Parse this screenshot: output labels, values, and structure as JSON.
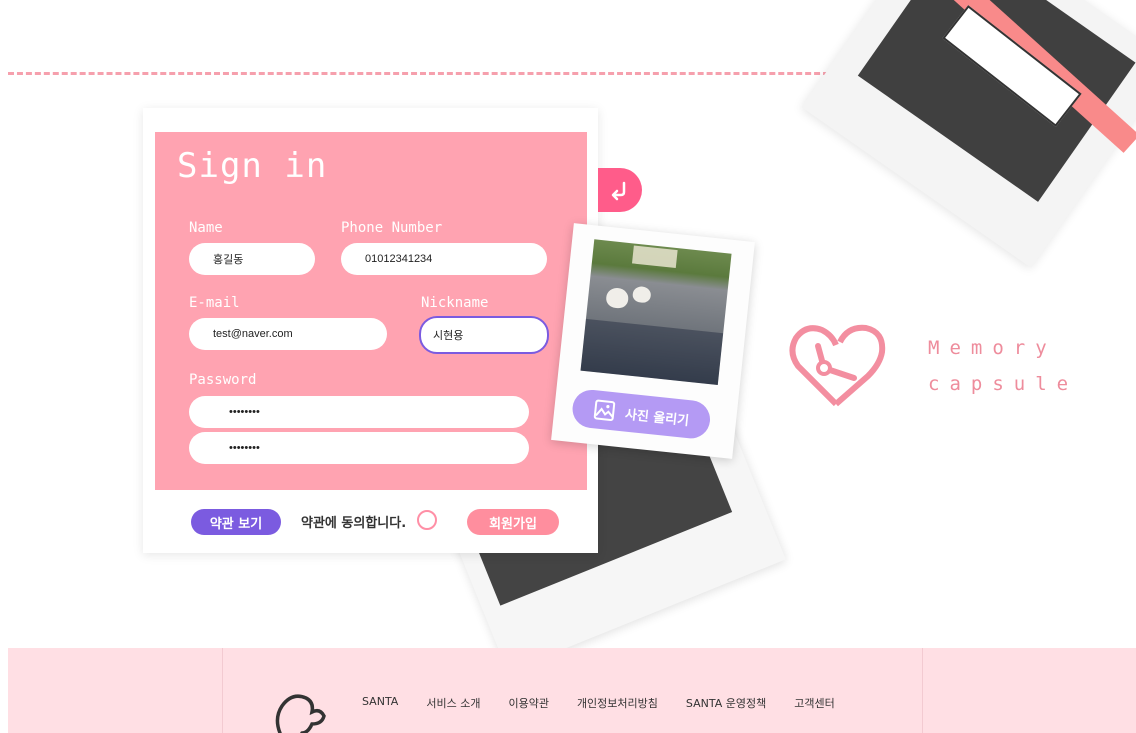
{
  "form": {
    "title": "Sign in",
    "name_label": "Name",
    "name_value": "홍길동",
    "phone_label": "Phone Number",
    "phone_value": "01012341234",
    "email_label": "E-mail",
    "email_value": "test@naver.com",
    "nickname_label": "Nickname",
    "nickname_value": "시현용",
    "password_label": "Password",
    "password_value": "••••••••",
    "password_confirm_value": "••••••••"
  },
  "actions": {
    "terms_button": "약관 보기",
    "agree_text": "약관에 동의합니다.",
    "join_button": "회원가입",
    "upload_button": "사진 올리기"
  },
  "brand": {
    "line1": "Memory",
    "line2": "capsule"
  },
  "footer": {
    "nav": [
      "SANTA",
      "서비스 소개",
      "이용약관",
      "개인정보처리방침",
      "SANTA 운영정책",
      "고객센터"
    ]
  },
  "colors": {
    "panel_pink": "#ffa3b1",
    "accent_purple": "#7b5be0",
    "footer_bg": "#ffdfe4"
  }
}
